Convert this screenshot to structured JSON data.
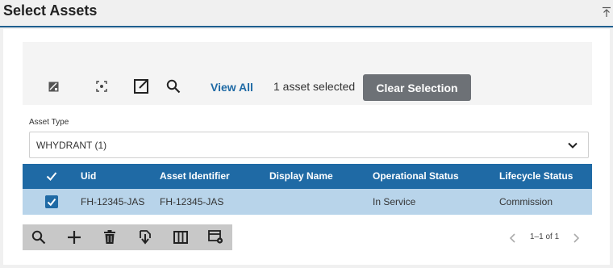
{
  "header": {
    "title": "Select Assets"
  },
  "toolbar": {
    "icons": [
      "image-edit-icon",
      "focus-icon",
      "open-external-icon",
      "search-icon"
    ],
    "view_all_label": "View All",
    "selection_text": "1 asset selected",
    "clear_selection_label": "Clear Selection"
  },
  "filter": {
    "label": "Asset Type",
    "value": "WHYDRANT (1)"
  },
  "table": {
    "columns": [
      "Uid",
      "Asset Identifier",
      "Display Name",
      "Operational Status",
      "Lifecycle Status"
    ],
    "rows": [
      {
        "selected": true,
        "uid": "FH-12345-JAS",
        "asset_identifier": "FH-12345-JAS",
        "display_name": "",
        "operational_status": "In Service",
        "lifecycle_status": "Commission"
      }
    ]
  },
  "bottom_toolbar": {
    "icons": [
      "search-icon",
      "add-icon",
      "delete-icon",
      "download-icon",
      "columns-icon",
      "table-settings-icon"
    ]
  },
  "pager": {
    "text": "1–1 of 1"
  },
  "colors": {
    "accent": "#1f6aa5",
    "selected_row": "#b8d4ea",
    "clear_button": "#6d7176"
  }
}
